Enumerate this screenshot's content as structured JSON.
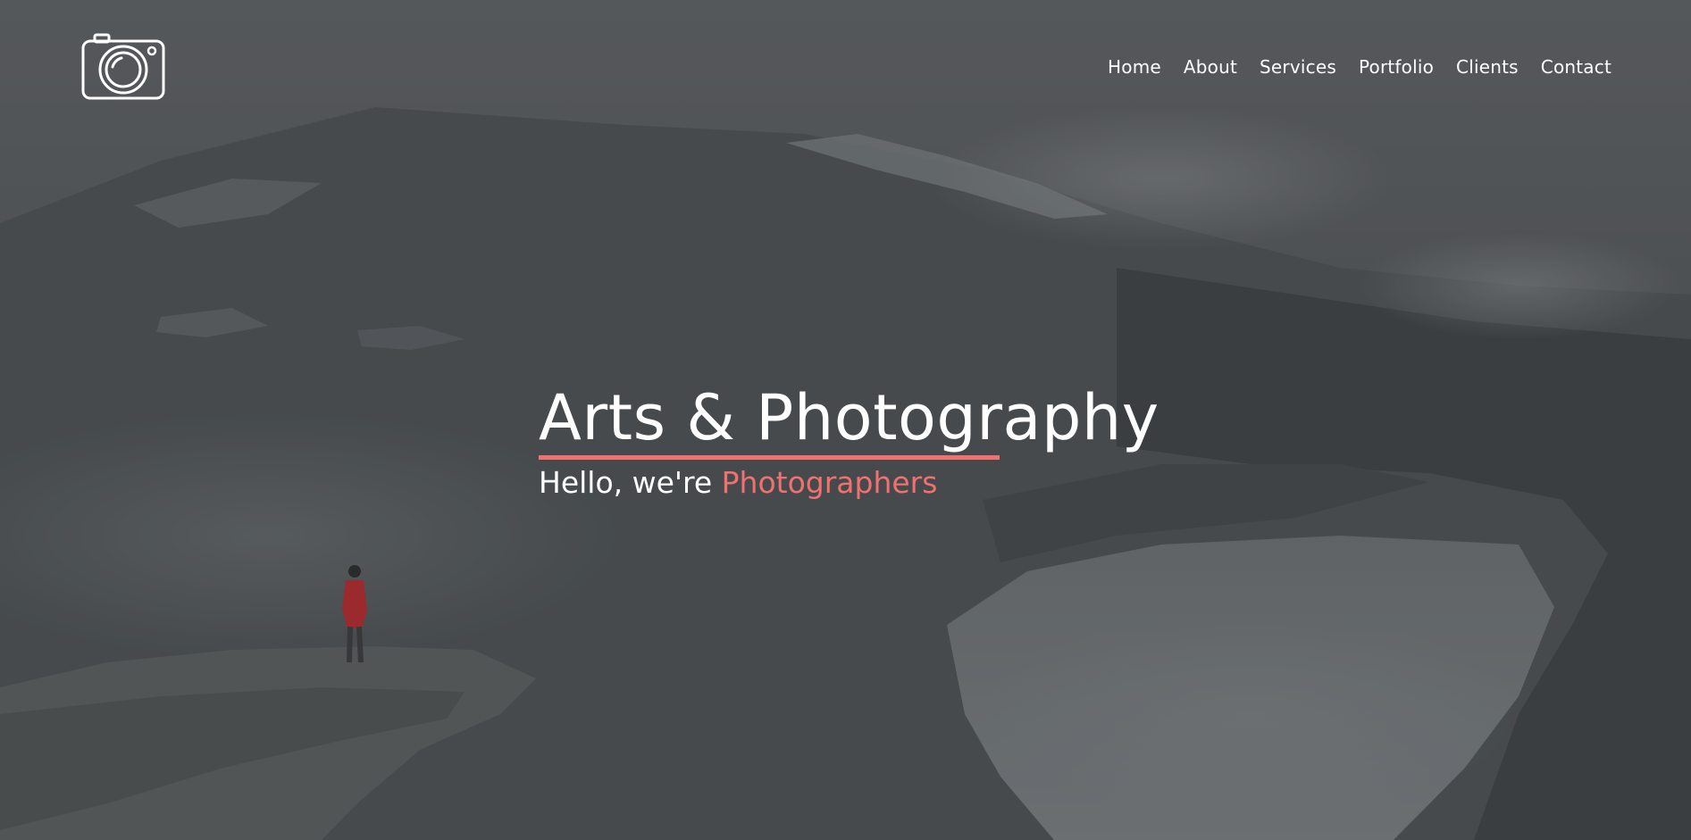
{
  "nav": {
    "items": [
      {
        "label": "Home"
      },
      {
        "label": "About"
      },
      {
        "label": "Services"
      },
      {
        "label": "Portfolio"
      },
      {
        "label": "Clients"
      },
      {
        "label": "Contact"
      }
    ]
  },
  "hero": {
    "title": "Arts & Photography",
    "subtitle_prefix": "Hello, we're ",
    "subtitle_accent": "Photographers"
  },
  "colors": {
    "accent": "#f0716f",
    "text": "#ffffff"
  },
  "icons": {
    "logo": "camera-icon"
  }
}
